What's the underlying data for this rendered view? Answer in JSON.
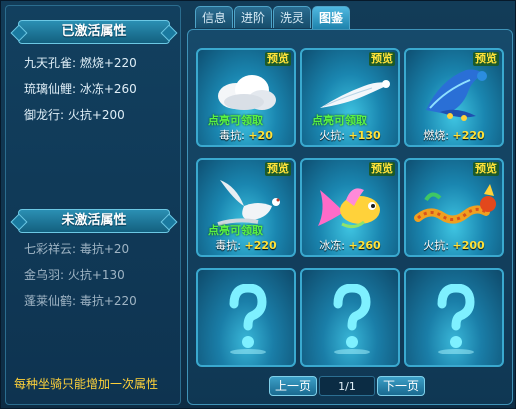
{
  "left": {
    "activated_title": "已激活属性",
    "activated": [
      "九天孔雀: 燃烧+220",
      "琉璃仙鲤: 冰冻+260",
      "御龙行: 火抗+200"
    ],
    "inactive_title": "未激活属性",
    "inactive": [
      "七彩祥云: 毒抗+20",
      "金乌羽: 火抗+130",
      "蓬莱仙鹤: 毒抗+220"
    ],
    "tip": "每种坐骑只能增加一次属性"
  },
  "tabs": [
    {
      "label": "信息",
      "active": false
    },
    {
      "label": "进阶",
      "active": false
    },
    {
      "label": "洗灵",
      "active": false
    },
    {
      "label": "图鉴",
      "active": true
    }
  ],
  "cards": [
    {
      "name": "cloud",
      "preview": "预览",
      "claim": "点亮可领取",
      "stat_label": "毒抗:",
      "stat_value": "+20"
    },
    {
      "name": "golden-crow-feather",
      "preview": "预览",
      "claim": "点亮可领取",
      "stat_label": "火抗:",
      "stat_value": "+130"
    },
    {
      "name": "peacock",
      "preview": "预览",
      "claim": "",
      "stat_label": "燃烧:",
      "stat_value": "+220"
    },
    {
      "name": "crane",
      "preview": "预览",
      "claim": "点亮可领取",
      "stat_label": "毒抗:",
      "stat_value": "+220"
    },
    {
      "name": "koi",
      "preview": "预览",
      "claim": "",
      "stat_label": "冰冻:",
      "stat_value": "+260"
    },
    {
      "name": "dragon",
      "preview": "预览",
      "claim": "",
      "stat_label": "火抗:",
      "stat_value": "+200"
    }
  ],
  "empty_slots": 3,
  "pager": {
    "prev": "上一页",
    "page": "1/1",
    "next": "下一页"
  },
  "colors": {
    "accent": "#3aa9cf",
    "gold": "#ffe23a",
    "claim": "#59f244"
  }
}
